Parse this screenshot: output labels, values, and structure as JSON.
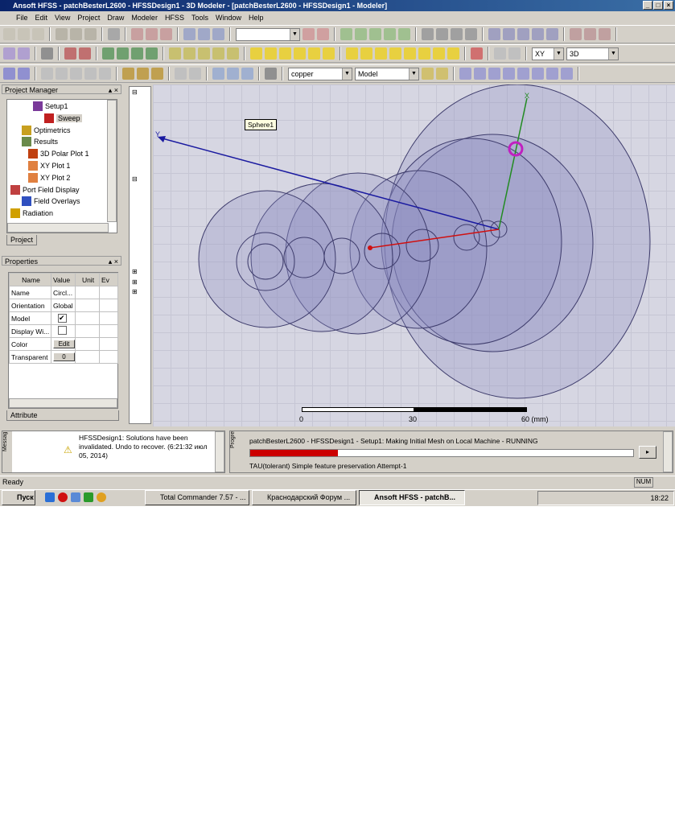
{
  "title": "Ansoft HFSS - patchBesterL2600 - HFSSDesign1 - 3D Modeler - [patchBesterL2600 - HFSSDesign1 - Modeler]",
  "menu": [
    "File",
    "Edit",
    "View",
    "Project",
    "Draw",
    "Modeler",
    "HFSS",
    "Tools",
    "Window",
    "Help"
  ],
  "toolbar": {
    "material": "copper",
    "model_combo": "Model",
    "plane": "XY",
    "view_mode": "3D"
  },
  "project_manager": {
    "title": "Project Manager",
    "tab": "Project",
    "items": [
      {
        "label": "Setup1",
        "icon": "setup-icon"
      },
      {
        "label": "Sweep",
        "icon": "sweep-icon"
      },
      {
        "label": "Optimetrics",
        "icon": "optimetrics-icon"
      },
      {
        "label": "Results",
        "icon": "results-icon"
      },
      {
        "label": "3D Polar Plot 1",
        "icon": "polar-plot-icon"
      },
      {
        "label": "XY Plot 1",
        "icon": "xy-plot-icon"
      },
      {
        "label": "XY Plot 2",
        "icon": "xy-plot-icon"
      },
      {
        "label": "Port Field Display",
        "icon": "port-field-icon"
      },
      {
        "label": "Field Overlays",
        "icon": "field-overlays-icon"
      },
      {
        "label": "Radiation",
        "icon": "radiation-icon"
      }
    ]
  },
  "properties": {
    "title": "Properties",
    "tab": "Attribute",
    "columns": [
      "Name",
      "Value",
      "Unit",
      "Ev"
    ],
    "rows": [
      {
        "name": "Name",
        "value": "Circl..."
      },
      {
        "name": "Orientation",
        "value": "Global"
      },
      {
        "name": "Model",
        "value": "✔"
      },
      {
        "name": "Display Wi...",
        "value": ""
      },
      {
        "name": "Color",
        "value": "Edit"
      },
      {
        "name": "Transparent",
        "value": "0"
      }
    ]
  },
  "viewport": {
    "tooltip": "Sphere1",
    "axes": {
      "x": "X",
      "y": "Y"
    },
    "scale": {
      "labels": [
        "0",
        "30",
        "60 (mm)"
      ]
    }
  },
  "colors": {
    "axis_x": "#228b22",
    "axis_y": "#1a1aa0",
    "axis_z": "#d01010",
    "progress": "#cc0000"
  },
  "messages": {
    "label": "Messag",
    "text": "HFSSDesign1: Solutions have been invalidated. Undo to recover. (6:21:32 июл 05, 2014)"
  },
  "progress": {
    "label": "Progre",
    "task": "patchBesterL2600 - HFSSDesign1 - Setup1: Making Initial Mesh on Local Machine - RUNNING",
    "fraction": 0.23,
    "detail": "TAU(tolerant) Simple feature preservation   Attempt-1"
  },
  "status": {
    "text": "Ready",
    "num": "NUM"
  },
  "taskbar": {
    "start": "Пуск",
    "windows": [
      "Total Commander 7.57 - ...",
      "Краснодарский Форум ...",
      "Ansoft HFSS - patchB..."
    ],
    "time": "18:22"
  }
}
